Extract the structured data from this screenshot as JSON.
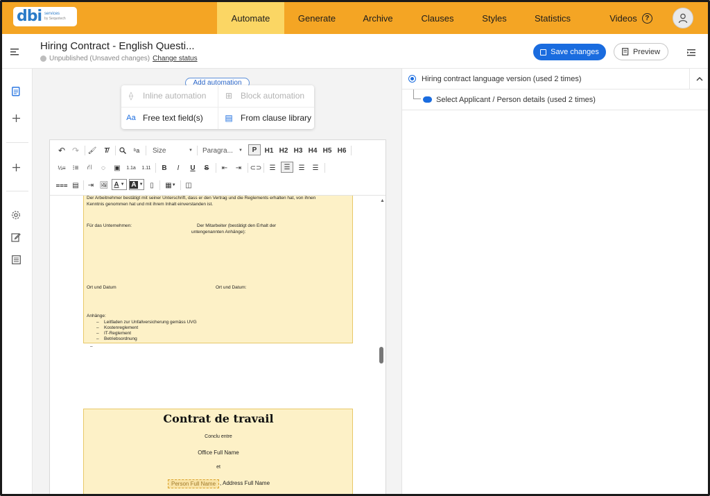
{
  "nav": {
    "logo_text": "dbi",
    "logo_sub1": "services",
    "logo_sub2": "by Sequotech",
    "tabs": [
      {
        "label": "Automate",
        "active": true
      },
      {
        "label": "Generate"
      },
      {
        "label": "Archive"
      },
      {
        "label": "Clauses"
      },
      {
        "label": "Styles"
      },
      {
        "label": "Statistics"
      },
      {
        "label": "Videos"
      }
    ],
    "help_glyph": "?"
  },
  "header": {
    "title": "Hiring Contract - English Questi...",
    "status": "Unpublished (Unsaved changes)",
    "change_status": "Change status",
    "save_label": "Save changes",
    "preview_label": "Preview"
  },
  "automation": {
    "add_label": "Add automation",
    "inline": "Inline automation",
    "block": "Block automation",
    "free_text": "Free text field(s)",
    "clause_library": "From clause library"
  },
  "toolbar": {
    "size": "Size",
    "paragraph": "Paragra...",
    "p": "P",
    "h1": "H1",
    "h2": "H2",
    "h3": "H3",
    "h4": "H4",
    "h5": "H5",
    "h6": "H6",
    "bold": "B",
    "italic": "I",
    "underline": "U",
    "strike": "S",
    "font_color": "A",
    "bg_color": "A"
  },
  "document": {
    "para1_line1": "Der Arbeitnehmer bestätigt mit seiner Unterschrift, dass er den Vertrag und die Reglements erhalten hat, von ihnen",
    "para1_line2": "Kenntnis genommen hat und mit ihrem Inhalt einverstanden ist.",
    "company": "Für das Unternehmen:",
    "employee_line1": "Der Mitarbeiter (bestätigt den Erhalt der",
    "employee_line2": "untengenannten Anhänge):",
    "place_date_left": "Ort und Datum",
    "place_date_right": "Ort und Datum:",
    "annexes": "Anhänge:",
    "annex_items": [
      "Leitfaden zur Unfallversicherung gemäss UVG",
      "Kostenreglement",
      "IT-Reglement",
      "Betriebsordnung"
    ],
    "dash": "–",
    "contract_title": "Contrat de travail",
    "concluded": "Conclu entre",
    "office_name": "Office Full Name",
    "and": "et",
    "person_tag": "Person Full Name",
    "address": ", Address Full Name"
  },
  "right_panel": {
    "item1": "Hiring contract language version (used 2 times)",
    "item2": "Select Applicant / Person details (used 2 times)"
  },
  "colors": {
    "accent_orange": "#f4a524",
    "active_tab": "#fbd664",
    "primary_blue": "#1a6cdf",
    "block_fill": "#fdf1c7"
  }
}
